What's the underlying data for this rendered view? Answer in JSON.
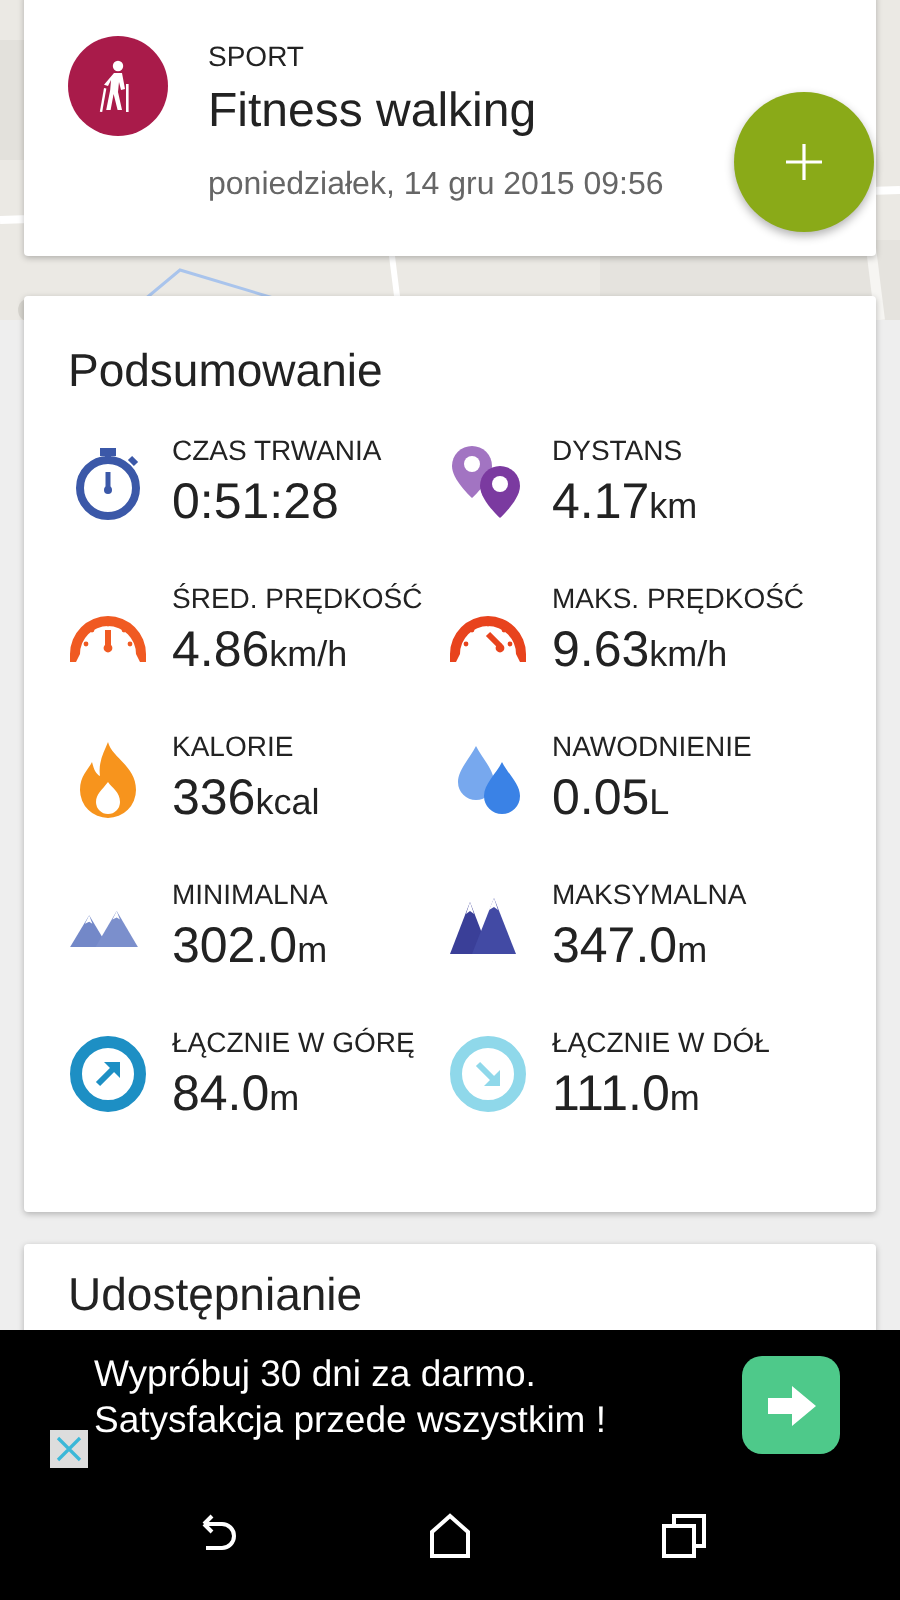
{
  "activity": {
    "category": "SPORT",
    "title": "Fitness walking",
    "datetime": "poniedziałek, 14 gru 2015 09:56"
  },
  "summary": {
    "title": "Podsumowanie",
    "stats": [
      {
        "kind": "stopwatch",
        "label": "CZAS TRWANIA",
        "value": "0:51:28"
      },
      {
        "kind": "pins",
        "label": "DYSTANS",
        "value": "4.17",
        "unit": "km"
      },
      {
        "kind": "gauge-avg",
        "label": "ŚRED. PRĘDKOŚĆ",
        "value": "4.86",
        "unit": "km/h"
      },
      {
        "kind": "gauge-max",
        "label": "MAKS. PRĘDKOŚĆ",
        "value": "9.63",
        "unit": "km/h"
      },
      {
        "kind": "flame",
        "label": "KALORIE",
        "value": "336",
        "unit": "kcal"
      },
      {
        "kind": "drops",
        "label": "NAWODNIENIE",
        "value": "0.05",
        "unit": "L"
      },
      {
        "kind": "mountains-low",
        "label": "MINIMALNA",
        "value": "302.0",
        "unit": "m"
      },
      {
        "kind": "mountains-high",
        "label": "MAKSYMALNA",
        "value": "347.0",
        "unit": "m"
      },
      {
        "kind": "ascent",
        "label": "ŁĄCZNIE W GÓRĘ",
        "value": "84.0",
        "unit": "m"
      },
      {
        "kind": "descent",
        "label": "ŁĄCZNIE W DÓŁ",
        "value": "111.0",
        "unit": "m"
      }
    ]
  },
  "share": {
    "title": "Udostępnianie"
  },
  "ad": {
    "lines": [
      "Wypróbuj 30 dni za darmo.",
      "Satysfakcja przede wszystkim !"
    ]
  }
}
